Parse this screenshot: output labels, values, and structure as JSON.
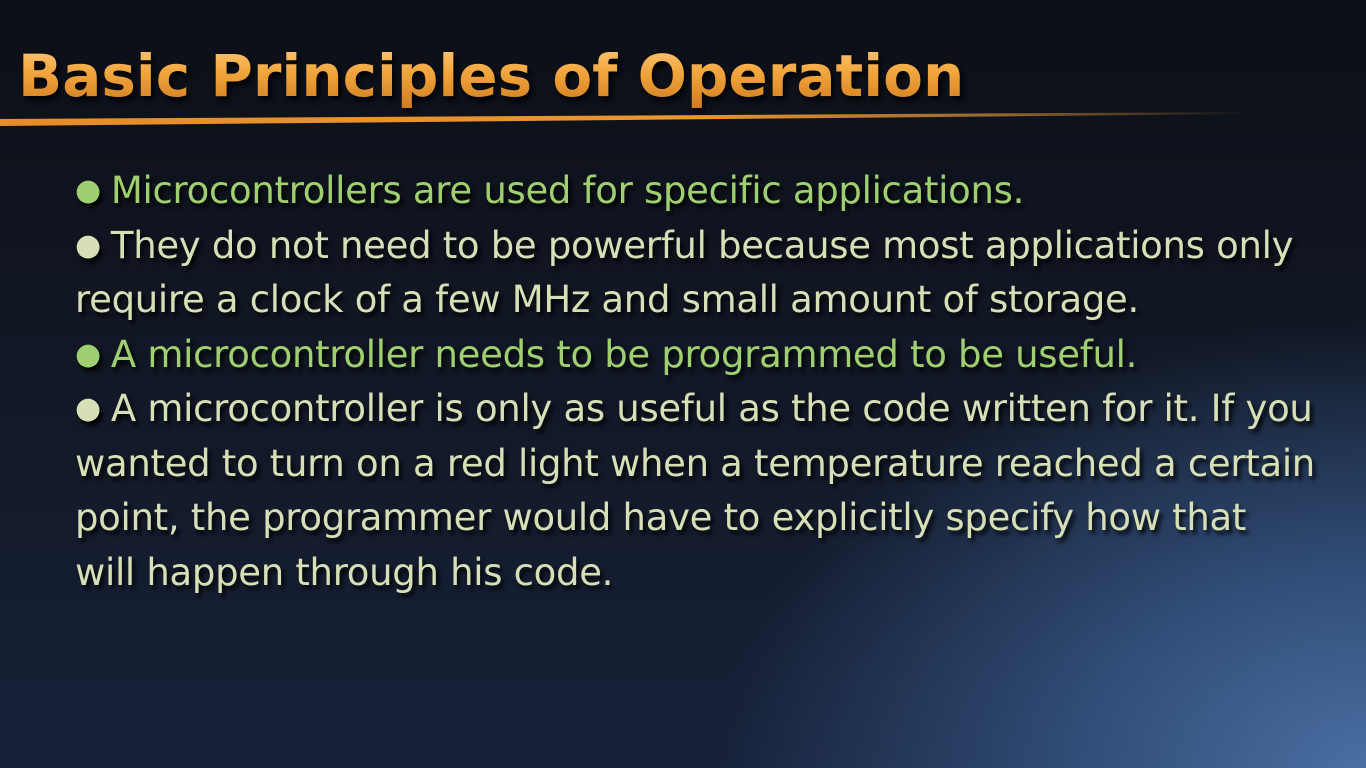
{
  "slide": {
    "title": "Basic Principles of Operation",
    "bullet_glyph": "●",
    "bullets": [
      {
        "text": "Microcontrollers are used for specific applications.",
        "color": "#9fcf70"
      },
      {
        "text": "They do not need to be powerful because most applications only require a clock of a few MHz and small amount of storage.",
        "color": "#d6dfb6"
      },
      {
        "text": "A microcontroller needs to be programmed to be useful.",
        "color": "#9fcf70"
      },
      {
        "text": "A microcontroller is only as useful as the code written for it. If you wanted to turn on a red light when a temperature reached a certain point, the programmer would have to explicitly specify how that will happen through his code.",
        "color": "#d6dfb6"
      }
    ],
    "colors": {
      "title": "#f0a53a",
      "accent_rule": "#e68c28",
      "background_dark": "#0c0f16",
      "background_light": "#4a6fa3"
    }
  }
}
